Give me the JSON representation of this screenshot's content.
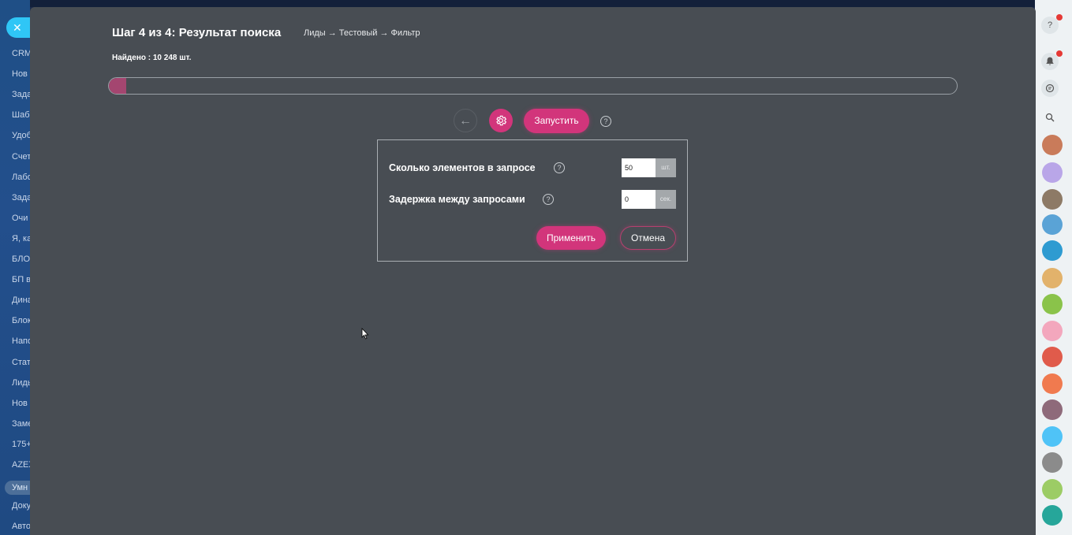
{
  "sidebar": {
    "items": [
      "CRM",
      "Нов",
      "Зада",
      "Шаб",
      "Удоб",
      "Счет",
      "Лабо",
      "Зада",
      "Очи",
      "Я, ка",
      "БЛО",
      "БП в",
      "Дина",
      "Блок",
      "Напо",
      "Стат",
      "Лиды",
      "Нов",
      "Заме",
      "175+",
      "AZEX",
      "Умн",
      "Доку",
      "Авто"
    ],
    "active_index": 21
  },
  "header": {
    "title": "Шаг 4 из 4: Результат поиска",
    "breadcrumbs": "Лиды → Тестовый → Фильтр",
    "found": "Найдено : 10 248 шт."
  },
  "progress": {
    "percent": 2,
    "color": "#a44670"
  },
  "toolbar": {
    "back_icon": "←",
    "run_label": "Запустить",
    "help": "?"
  },
  "settings": {
    "batch": {
      "label": "Сколько элементов в запросе",
      "value": "50",
      "unit": "шт.",
      "help": "?"
    },
    "delay": {
      "label": "Задержка между запросами",
      "value": "0",
      "unit": "сек.",
      "help": "?"
    },
    "apply_label": "Применить",
    "cancel_label": "Отмена"
  },
  "rightbar": {
    "help_label": "?"
  },
  "colors": {
    "accent": "#d2357b",
    "panel": "#484d53",
    "close": "#2fc6f6"
  }
}
